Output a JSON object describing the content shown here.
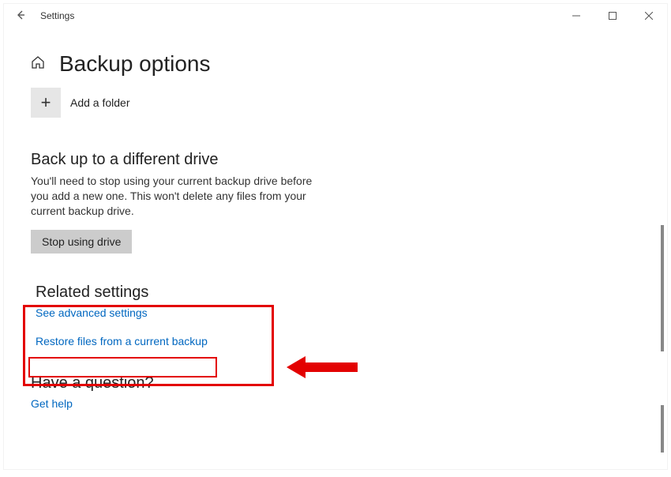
{
  "titlebar": {
    "app_title": "Settings"
  },
  "page": {
    "title": "Backup options"
  },
  "add_folder": {
    "label": "Add a folder"
  },
  "different_drive": {
    "heading": "Back up to a different drive",
    "body": "You'll need to stop using your current backup drive before you add a new one. This won't delete any files from your current backup drive.",
    "button": "Stop using drive"
  },
  "related": {
    "heading": "Related settings",
    "advanced_link": "See advanced settings",
    "restore_link": "Restore files from a current backup"
  },
  "question": {
    "heading": "Have a question?",
    "help_link": "Get help"
  }
}
